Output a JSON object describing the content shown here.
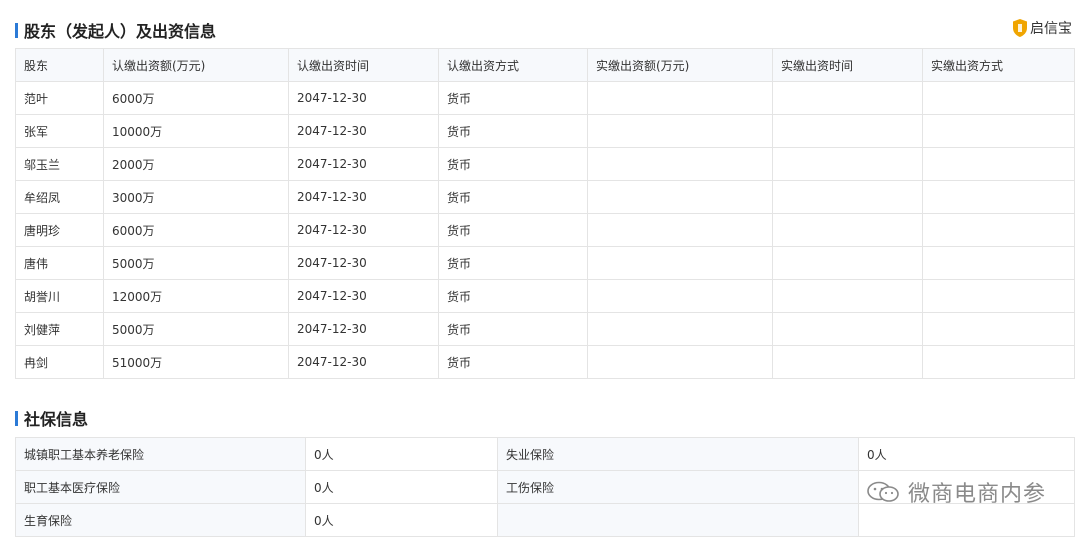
{
  "shareholders_section": {
    "title": "股东（发起人）及出资信息",
    "brand": "启信宝",
    "columns": [
      "股东",
      "认缴出资额(万元)",
      "认缴出资时间",
      "认缴出资方式",
      "实缴出资额(万元)",
      "实缴出资时间",
      "实缴出资方式"
    ],
    "rows": [
      {
        "name": "范叶",
        "amount": "6000万",
        "date": "2047-12-30",
        "method": "货币",
        "paid_amount": "",
        "paid_date": "",
        "paid_method": ""
      },
      {
        "name": "张军",
        "amount": "10000万",
        "date": "2047-12-30",
        "method": "货币",
        "paid_amount": "",
        "paid_date": "",
        "paid_method": ""
      },
      {
        "name": "邬玉兰",
        "amount": "2000万",
        "date": "2047-12-30",
        "method": "货币",
        "paid_amount": "",
        "paid_date": "",
        "paid_method": ""
      },
      {
        "name": "牟绍凤",
        "amount": "3000万",
        "date": "2047-12-30",
        "method": "货币",
        "paid_amount": "",
        "paid_date": "",
        "paid_method": ""
      },
      {
        "name": "唐明珍",
        "amount": "6000万",
        "date": "2047-12-30",
        "method": "货币",
        "paid_amount": "",
        "paid_date": "",
        "paid_method": ""
      },
      {
        "name": "唐伟",
        "amount": "5000万",
        "date": "2047-12-30",
        "method": "货币",
        "paid_amount": "",
        "paid_date": "",
        "paid_method": ""
      },
      {
        "name": "胡誉川",
        "amount": "12000万",
        "date": "2047-12-30",
        "method": "货币",
        "paid_amount": "",
        "paid_date": "",
        "paid_method": ""
      },
      {
        "name": "刘健萍",
        "amount": "5000万",
        "date": "2047-12-30",
        "method": "货币",
        "paid_amount": "",
        "paid_date": "",
        "paid_method": ""
      },
      {
        "name": "冉剑",
        "amount": "51000万",
        "date": "2047-12-30",
        "method": "货币",
        "paid_amount": "",
        "paid_date": "",
        "paid_method": ""
      }
    ]
  },
  "social_section": {
    "title": "社保信息",
    "rows": [
      {
        "label1": "城镇职工基本养老保险",
        "value1": "0人",
        "label2": "失业保险",
        "value2": "0人"
      },
      {
        "label1": "职工基本医疗保险",
        "value1": "0人",
        "label2": "工伤保险",
        "value2": ""
      },
      {
        "label1": "生育保险",
        "value1": "0人",
        "label2": "",
        "value2": ""
      }
    ]
  },
  "watermark": {
    "text": "微商电商内参"
  },
  "colors": {
    "accent": "#2b7ad6",
    "brand_gold": "#f0a500",
    "border": "#e4e4e4",
    "header_bg": "#f7f9fc"
  },
  "icons": {
    "brand_icon": "shield-icon",
    "watermark_icon": "wechat-icon"
  }
}
